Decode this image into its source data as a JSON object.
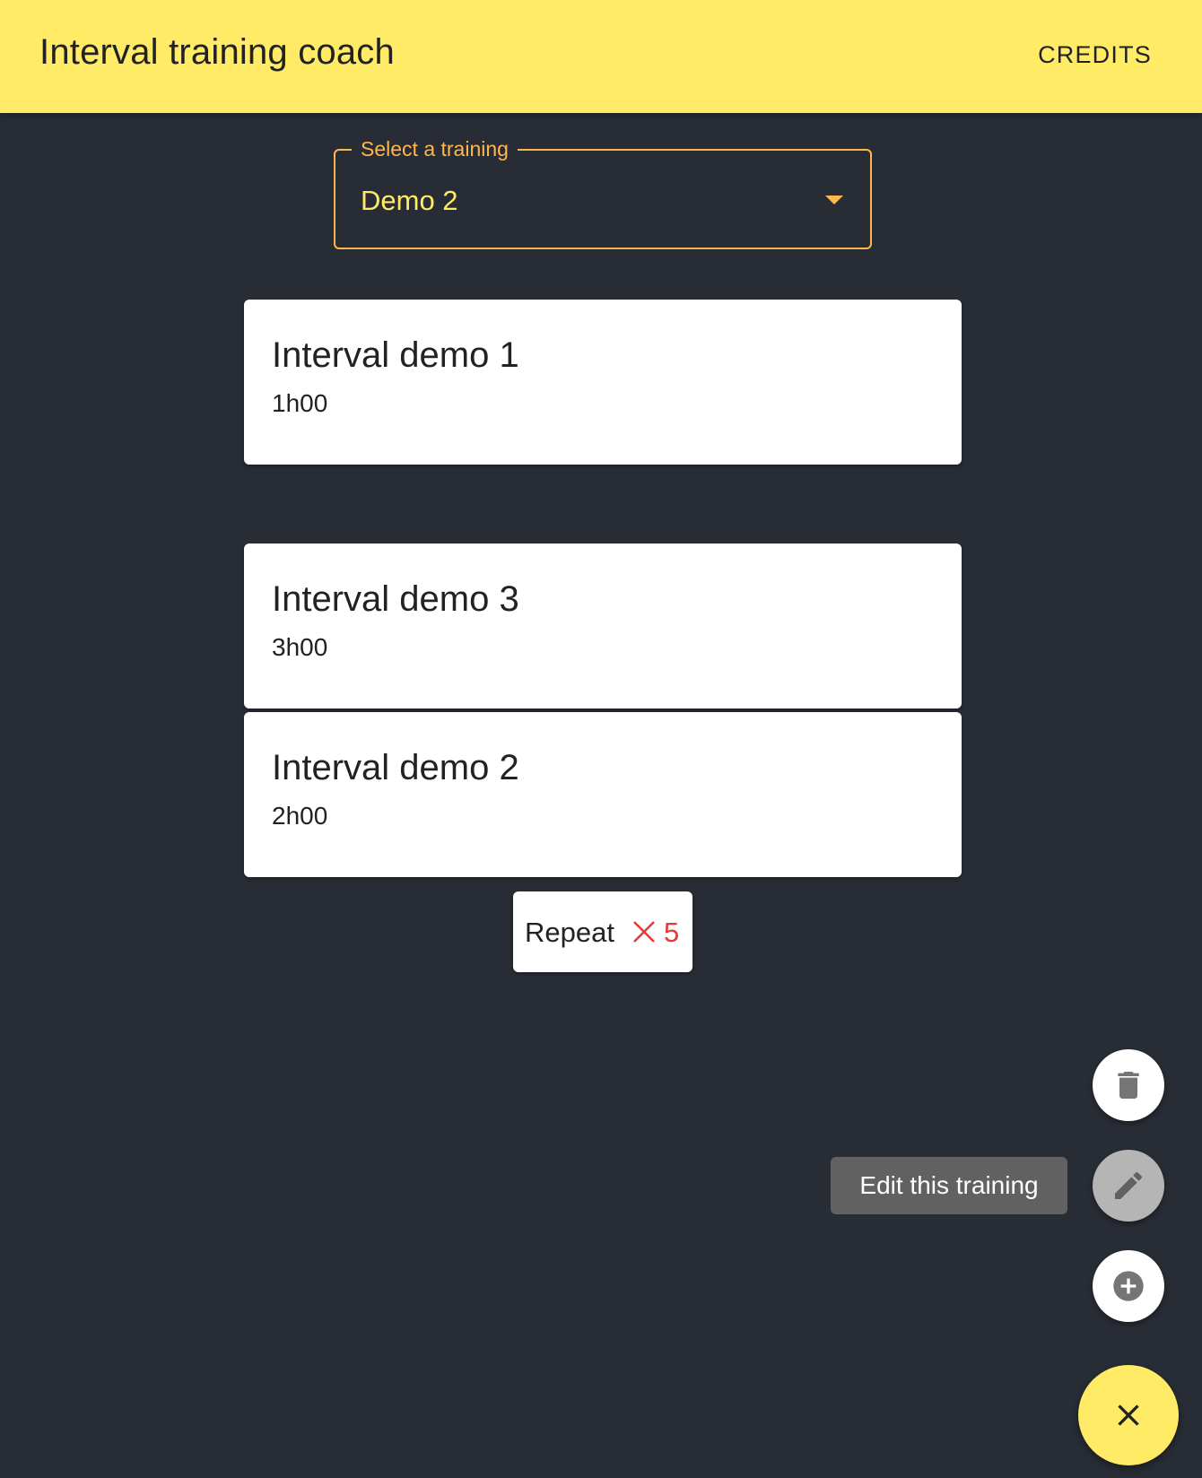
{
  "appbar": {
    "title": "Interval training coach",
    "credits_label": "CREDITS",
    "background_color": "#ffeb66"
  },
  "training_select": {
    "label": "Select a training",
    "value": "Demo 2",
    "accent_color": "#ffb74d",
    "value_color": "#ffeb66"
  },
  "intervals": [
    {
      "title": "Interval demo 1",
      "duration": "1h00"
    },
    {
      "title": "Interval demo 3",
      "duration": "3h00"
    },
    {
      "title": "Interval demo 2",
      "duration": "2h00"
    }
  ],
  "repeat": {
    "label": "Repeat",
    "icon": "close-icon",
    "count": "5",
    "count_color": "#e53935"
  },
  "speed_dial": {
    "actions": [
      {
        "name": "delete",
        "icon": "trash-icon"
      },
      {
        "name": "edit",
        "icon": "pencil-icon",
        "tooltip": "Edit this training"
      },
      {
        "name": "add",
        "icon": "add-circle-icon"
      }
    ],
    "main_icon": "close-icon",
    "main_color": "#ffeb66"
  }
}
